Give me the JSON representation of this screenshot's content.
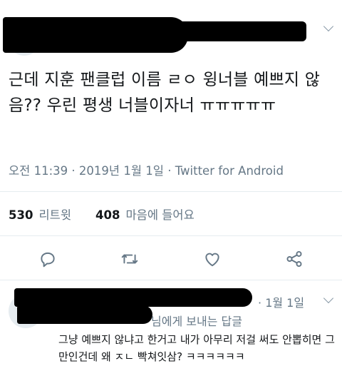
{
  "tweet": {
    "text": "근데 지훈 팬클럽 이름 ㄹㅇ 윙너블 예쁘지 않음?? 우린 평생 너블이자너 ㅠㅠㅠㅠㅠ",
    "time": "오전 11:39",
    "date": "2019년 1월 1일",
    "source": "Twitter for Android",
    "retweets_count": "530",
    "retweets_label": "리트윗",
    "likes_count": "408",
    "likes_label": "마음에 들어요",
    "sep": "·"
  },
  "actions": [
    "reply-icon",
    "retweet-icon",
    "like-icon",
    "share-icon"
  ],
  "reply": {
    "dot": "·",
    "date": "1월 1일",
    "reply_to": "님에게 보내는 답글",
    "text": "그냥 예쁘지 않냐고 한거고 내가 아무리 저걸 써도 안뽑히면 그만인건데 왜 ㅈㄴ 빡쳐잇삼? ㅋㅋㅋㅋㅋㅋ"
  },
  "colors": {
    "secondary_text": "#657786",
    "icon": "#657786",
    "divider": "#e6ecf0"
  }
}
